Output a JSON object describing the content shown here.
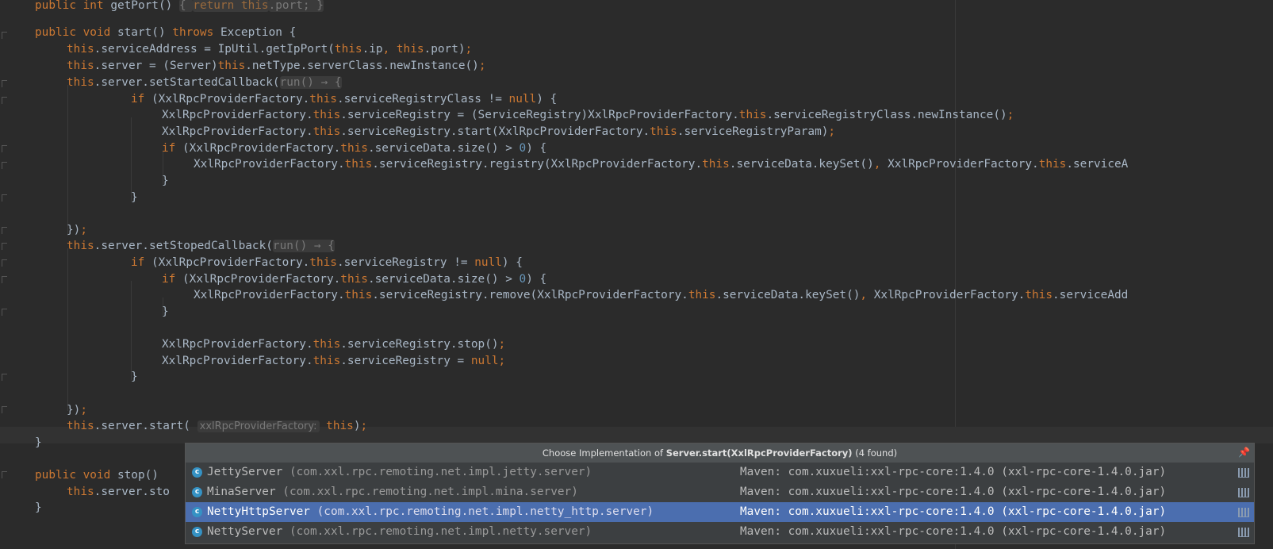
{
  "editor": {
    "lines": [
      {
        "id": "l0",
        "parts": [
          [
            "kw",
            "public int "
          ],
          [
            "",
            "getPort() "
          ],
          [
            "hint",
            "{ "
          ],
          [
            "hintkw",
            "return this"
          ],
          [
            "hint",
            ".port; }"
          ]
        ]
      },
      {
        "id": "l1",
        "parts": [
          [
            "kw",
            "public void "
          ],
          [
            "",
            "start() "
          ],
          [
            "kw",
            "throws "
          ],
          [
            "",
            "Exception {"
          ]
        ]
      },
      {
        "id": "l2",
        "parts": [
          [
            "kw",
            "this"
          ],
          [
            "",
            ".serviceAddress = IpUtil.getIpPort("
          ],
          [
            "kw",
            "this"
          ],
          [
            "",
            ".ip"
          ],
          [
            "kw",
            ", this"
          ],
          [
            "",
            ".port)"
          ],
          [
            "kw",
            ";"
          ]
        ]
      },
      {
        "id": "l3",
        "parts": [
          [
            "kw",
            "this"
          ],
          [
            "",
            ".server = (Server)"
          ],
          [
            "kw",
            "this"
          ],
          [
            "",
            ".netType.serverClass.newInstance()"
          ],
          [
            "kw",
            ";"
          ]
        ]
      },
      {
        "id": "l4",
        "parts": [
          [
            "kw",
            "this"
          ],
          [
            "",
            ".server.setStartedCallback("
          ],
          [
            "hint",
            "run() → {"
          ]
        ]
      },
      {
        "id": "l5",
        "parts": [
          [
            "kw",
            "if "
          ],
          [
            "",
            "(XxlRpcProviderFactory."
          ],
          [
            "kw",
            "this"
          ],
          [
            "",
            ".serviceRegistryClass != "
          ],
          [
            "kw",
            "null"
          ],
          [
            "",
            ") {"
          ]
        ]
      },
      {
        "id": "l6",
        "parts": [
          [
            "",
            "XxlRpcProviderFactory."
          ],
          [
            "kw",
            "this"
          ],
          [
            "",
            ".serviceRegistry = (ServiceRegistry)XxlRpcProviderFactory."
          ],
          [
            "kw",
            "this"
          ],
          [
            "",
            ".serviceRegistryClass.newInstance()"
          ],
          [
            "kw",
            ";"
          ]
        ]
      },
      {
        "id": "l7",
        "parts": [
          [
            "",
            "XxlRpcProviderFactory."
          ],
          [
            "kw",
            "this"
          ],
          [
            "",
            ".serviceRegistry.start(XxlRpcProviderFactory."
          ],
          [
            "kw",
            "this"
          ],
          [
            "",
            ".serviceRegistryParam)"
          ],
          [
            "kw",
            ";"
          ]
        ]
      },
      {
        "id": "l8",
        "parts": [
          [
            "kw",
            "if "
          ],
          [
            "",
            "(XxlRpcProviderFactory."
          ],
          [
            "kw",
            "this"
          ],
          [
            "",
            ".serviceData.size() > "
          ],
          [
            "num",
            "0"
          ],
          [
            "",
            ") {"
          ]
        ]
      },
      {
        "id": "l9",
        "parts": [
          [
            "",
            "XxlRpcProviderFactory."
          ],
          [
            "kw",
            "this"
          ],
          [
            "",
            ".serviceRegistry.registry(XxlRpcProviderFactory."
          ],
          [
            "kw",
            "this"
          ],
          [
            "",
            ".serviceData.keySet()"
          ],
          [
            "kw",
            ", "
          ],
          [
            "",
            "XxlRpcProviderFactory."
          ],
          [
            "kw",
            "this"
          ],
          [
            "",
            ".serviceA"
          ]
        ]
      },
      {
        "id": "l10",
        "parts": [
          [
            "",
            "}"
          ]
        ]
      },
      {
        "id": "l11",
        "parts": [
          [
            "",
            "}"
          ]
        ]
      },
      {
        "id": "l12",
        "parts": [
          [
            "",
            "})"
          ],
          [
            "kw",
            ";"
          ]
        ]
      },
      {
        "id": "l13",
        "parts": [
          [
            "kw",
            "this"
          ],
          [
            "",
            ".server.setStopedCallback("
          ],
          [
            "hint",
            "run() → {"
          ]
        ]
      },
      {
        "id": "l14",
        "parts": [
          [
            "kw",
            "if "
          ],
          [
            "",
            "(XxlRpcProviderFactory."
          ],
          [
            "kw",
            "this"
          ],
          [
            "",
            ".serviceRegistry != "
          ],
          [
            "kw",
            "null"
          ],
          [
            "",
            ") {"
          ]
        ]
      },
      {
        "id": "l15",
        "parts": [
          [
            "kw",
            "if "
          ],
          [
            "",
            "(XxlRpcProviderFactory."
          ],
          [
            "kw",
            "this"
          ],
          [
            "",
            ".serviceData.size() > "
          ],
          [
            "num",
            "0"
          ],
          [
            "",
            ") {"
          ]
        ]
      },
      {
        "id": "l16",
        "parts": [
          [
            "",
            "XxlRpcProviderFactory."
          ],
          [
            "kw",
            "this"
          ],
          [
            "",
            ".serviceRegistry.remove(XxlRpcProviderFactory."
          ],
          [
            "kw",
            "this"
          ],
          [
            "",
            ".serviceData.keySet()"
          ],
          [
            "kw",
            ", "
          ],
          [
            "",
            "XxlRpcProviderFactory."
          ],
          [
            "kw",
            "this"
          ],
          [
            "",
            ".serviceAdd"
          ]
        ]
      },
      {
        "id": "l17",
        "parts": [
          [
            "",
            "}"
          ]
        ]
      },
      {
        "id": "l18",
        "parts": [
          [
            "",
            "XxlRpcProviderFactory."
          ],
          [
            "kw",
            "this"
          ],
          [
            "",
            ".serviceRegistry.stop()"
          ],
          [
            "kw",
            ";"
          ]
        ]
      },
      {
        "id": "l19",
        "parts": [
          [
            "",
            "XxlRpcProviderFactory."
          ],
          [
            "kw",
            "this"
          ],
          [
            "",
            ".serviceRegistry = "
          ],
          [
            "kw",
            "null;"
          ]
        ]
      },
      {
        "id": "l20",
        "parts": [
          [
            "",
            "}"
          ]
        ]
      },
      {
        "id": "l21",
        "parts": [
          [
            "",
            "})"
          ],
          [
            "kw",
            ";"
          ]
        ]
      },
      {
        "id": "l22",
        "parts": [
          [
            "kw",
            "this"
          ],
          [
            "",
            ".server.start( "
          ],
          [
            "param",
            "xxlRpcProviderFactory:"
          ],
          [
            "",
            " "
          ],
          [
            "kw",
            "this"
          ],
          [
            "",
            ")"
          ],
          [
            "kw",
            ";"
          ]
        ]
      },
      {
        "id": "l23",
        "parts": [
          [
            "",
            "}"
          ]
        ]
      },
      {
        "id": "l24",
        "parts": [
          [
            "kw",
            "public void "
          ],
          [
            "",
            "stop()"
          ]
        ]
      },
      {
        "id": "l25",
        "parts": [
          [
            "kw",
            "this"
          ],
          [
            "",
            ".server.sto"
          ]
        ]
      },
      {
        "id": "l26",
        "parts": [
          [
            "",
            "}"
          ]
        ]
      }
    ]
  },
  "popup": {
    "title_prefix": "Choose Implementation of ",
    "title_method": "Server.start(XxlRpcProviderFactory)",
    "title_suffix": " (4 found)",
    "pin_icon": "pin-icon",
    "items": [
      {
        "class": "JettyServer",
        "package": " (com.xxl.rpc.remoting.net.impl.jetty.server)",
        "maven": "Maven: com.xuxueli:xxl-rpc-core:1.4.0 (xxl-rpc-core-1.4.0.jar)",
        "selected": false
      },
      {
        "class": "MinaServer",
        "package": " (com.xxl.rpc.remoting.net.impl.mina.server)",
        "maven": "Maven: com.xuxueli:xxl-rpc-core:1.4.0 (xxl-rpc-core-1.4.0.jar)",
        "selected": false
      },
      {
        "class": "NettyHttpServer",
        "package": " (com.xxl.rpc.remoting.net.impl.netty_http.server)",
        "maven": "Maven: com.xuxueli:xxl-rpc-core:1.4.0 (xxl-rpc-core-1.4.0.jar)",
        "selected": true
      },
      {
        "class": "NettyServer",
        "package": " (com.xxl.rpc.remoting.net.impl.netty.server)",
        "maven": "Maven: com.xuxueli:xxl-rpc-core:1.4.0 (xxl-rpc-core-1.4.0.jar)",
        "selected": false
      }
    ],
    "class_icon_letter": "c"
  },
  "colors": {
    "keyword": "#cc7832",
    "number": "#6897bb",
    "text": "#a9b7c6",
    "selection": "#4b6eaf",
    "background": "#2b2b2b"
  }
}
